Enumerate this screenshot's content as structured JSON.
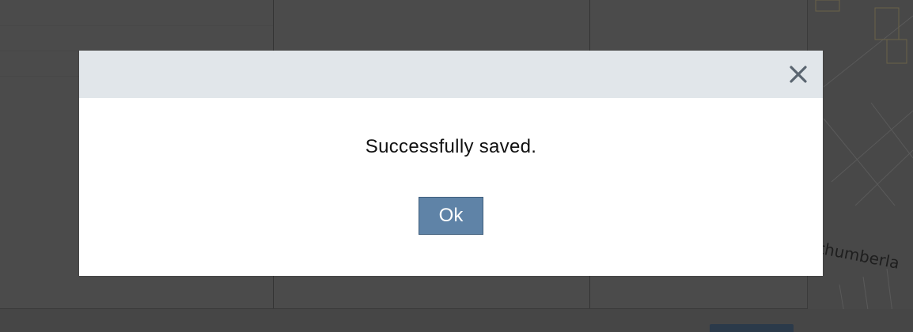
{
  "dialog": {
    "message": "Successfully saved.",
    "ok_label": "Ok",
    "close_icon": "close-icon",
    "colors": {
      "header_bg": "#e1e6ea",
      "ok_bg": "#5f83a7",
      "ok_border": "#3f5e7c",
      "overlay": "#4a4a4a"
    }
  },
  "map": {
    "street_label": "rthumberla"
  }
}
